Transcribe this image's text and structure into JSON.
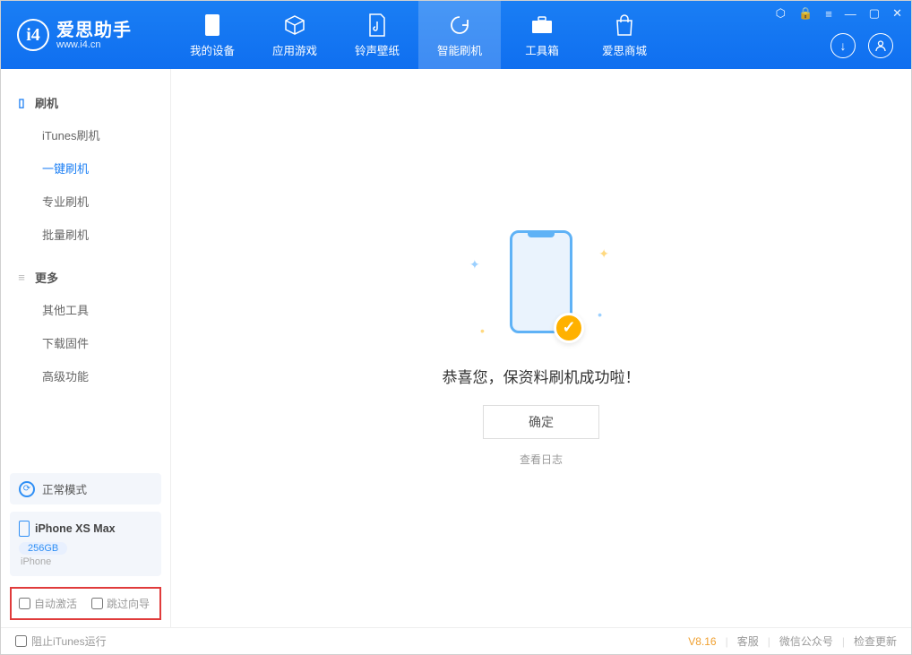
{
  "brand": {
    "name": "爱思助手",
    "site": "www.i4.cn"
  },
  "nav": {
    "0": {
      "label": "我的设备"
    },
    "1": {
      "label": "应用游戏"
    },
    "2": {
      "label": "铃声壁纸"
    },
    "3": {
      "label": "智能刷机"
    },
    "4": {
      "label": "工具箱"
    },
    "5": {
      "label": "爱思商城"
    }
  },
  "sidebar": {
    "group1": {
      "title": "刷机",
      "items": {
        "0": "iTunes刷机",
        "1": "一键刷机",
        "2": "专业刷机",
        "3": "批量刷机"
      }
    },
    "group2": {
      "title": "更多",
      "items": {
        "0": "其他工具",
        "1": "下载固件",
        "2": "高级功能"
      }
    },
    "mode": "正常模式",
    "device": {
      "name": "iPhone XS Max",
      "capacity": "256GB",
      "type": "iPhone"
    },
    "options": {
      "auto_activate": "自动激活",
      "skip_guide": "跳过向导"
    }
  },
  "main": {
    "success_msg": "恭喜您，保资料刷机成功啦！",
    "ok_label": "确定",
    "log_label": "查看日志"
  },
  "statusbar": {
    "block_itunes": "阻止iTunes运行",
    "version": "V8.16",
    "links": {
      "0": "客服",
      "1": "微信公众号",
      "2": "检查更新"
    }
  }
}
